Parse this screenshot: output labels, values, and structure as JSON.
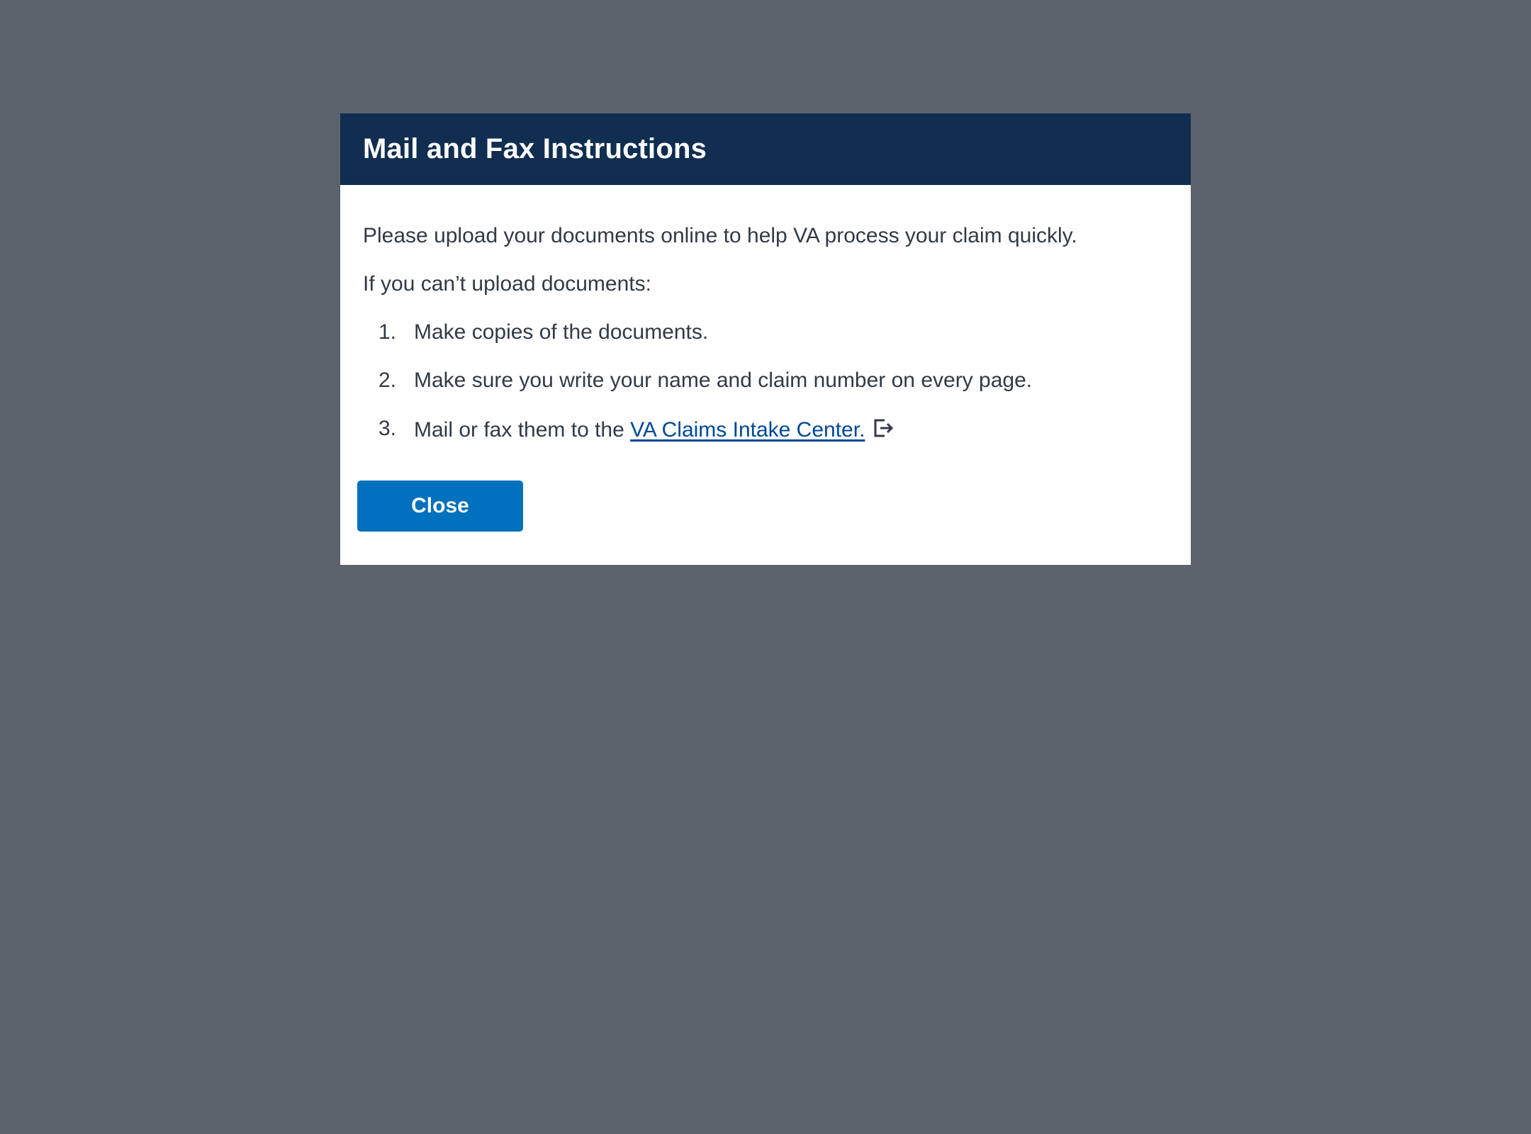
{
  "modal": {
    "title": "Mail and Fax Instructions",
    "intro": "Please upload your documents online to help VA process your claim quickly.",
    "subintro": "If you can’t upload documents:",
    "steps": [
      {
        "number": "1.",
        "text": "Make copies of the documents."
      },
      {
        "number": "2.",
        "text": "Make sure you write your name and claim number on every page."
      },
      {
        "number": "3.",
        "text": "Mail or fax them to the ",
        "link_text": "VA Claims Intake Center.",
        "link_icon": "external-link-icon"
      }
    ],
    "close_label": "Close"
  },
  "colors": {
    "overlay": "#5c636d",
    "header_bg": "#112e51",
    "button_bg": "#0071bc",
    "link": "#004795",
    "text": "#323a45"
  }
}
